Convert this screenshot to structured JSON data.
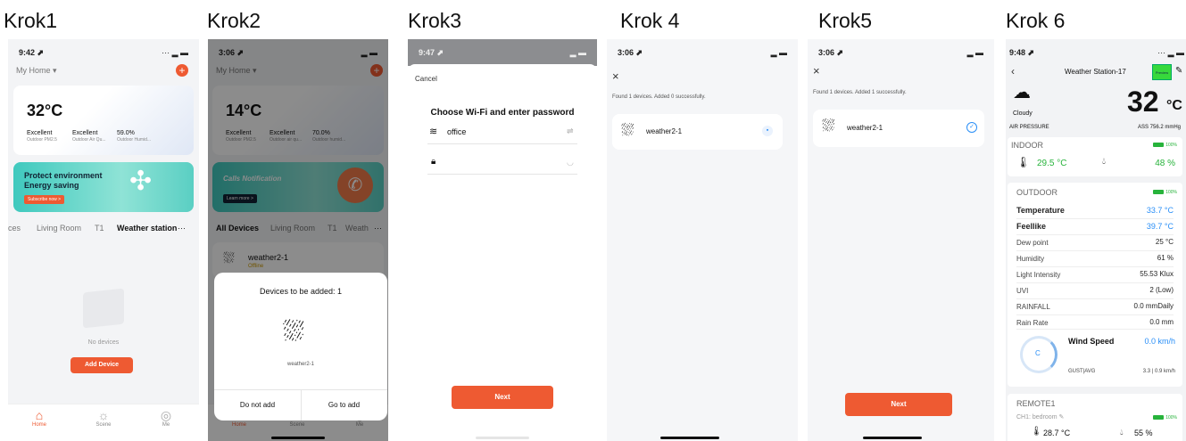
{
  "captions": [
    "Krok1",
    "Krok2",
    "Krok3",
    "Krok 4",
    "Krok5",
    "Krok 6"
  ],
  "colors": {
    "accent": "#ee5a32",
    "green": "#27b33b",
    "blue": "#2a8ff7"
  },
  "p1": {
    "time": "9:42 ⬈",
    "home": "My Home ▾",
    "temp": "32°C",
    "stats": [
      {
        "v": "Excellent",
        "l": "Outdoor PM2.5"
      },
      {
        "v": "Excellent",
        "l": "Outdoor Air Qu..."
      },
      {
        "v": "59.0%",
        "l": "Outdoor Humid..."
      }
    ],
    "banner_line1": "Protect environment",
    "banner_line2": "Energy saving",
    "banner_btn": "Subscribe now >",
    "rooms": [
      "ces",
      "Living Room",
      "T1",
      "Weather station",
      "···"
    ],
    "empty": "No devices",
    "add": "Add Device",
    "tabs": [
      "Home",
      "Scene",
      "Me"
    ]
  },
  "p2": {
    "time": "3:06 ⬈",
    "home": "My Home ▾",
    "temp": "14°C",
    "stats": [
      {
        "v": "Excellent",
        "l": "Outdoor PM2.5"
      },
      {
        "v": "Excellent",
        "l": "Outdoor air qu..."
      },
      {
        "v": "70.0%",
        "l": "Outdoor humid..."
      }
    ],
    "banner": "Calls Notification",
    "banner_btn": "Learn more >",
    "rooms": [
      "All Devices",
      "Living Room",
      "T1",
      "Weath",
      "···"
    ],
    "device": "weather2-1",
    "device_status": "Offline",
    "dialog_title": "Devices to be added: 1",
    "dialog_device": "weather2-1",
    "btn_no": "Do not add",
    "btn_go": "Go to add",
    "tabs": [
      "Home",
      "Scene",
      "Me"
    ]
  },
  "p3": {
    "time": "9:47 ⬈",
    "cancel": "Cancel",
    "title": "Choose Wi-Fi and enter password",
    "ssid": "office",
    "pwd_placeholder": "",
    "next": "Next"
  },
  "p4": {
    "time": "3:06 ⬈",
    "found": "Found 1 devices. Added 0 successfully.",
    "device": "weather2-1"
  },
  "p5": {
    "time": "3:06 ⬈",
    "found": "Found 1 devices. Added 1 successfully.",
    "device": "weather2-1",
    "next": "Next"
  },
  "p6": {
    "time": "9:48 ⬈",
    "title": "Weather Station-17",
    "preview": "Preview",
    "temp": "32",
    "unit": "°C",
    "cond": "Cloudy",
    "pressure_label": "AIR PRESSURE",
    "pressure": "ASS 756.2 mmHg",
    "indoor": "INDOOR",
    "indoor_batt": "100%",
    "indoor_temp": "29.5 °C",
    "indoor_hum": "48 %",
    "outdoor": "OUTDOOR",
    "outdoor_batt": "100%",
    "rows": [
      {
        "l": "Temperature",
        "v": "33.7 °C",
        "bold": true,
        "color": "#2a8ff7"
      },
      {
        "l": "Feellike",
        "v": "39.7 °C",
        "bold": true,
        "color": "#2a8ff7"
      },
      {
        "l": "Dew point",
        "v": "25 °C",
        "bold": false,
        "color": "#222"
      },
      {
        "l": "Humidity",
        "v": "61 %",
        "bold": false,
        "color": "#222"
      },
      {
        "l": "Light Intensity",
        "v": "55.53 Klux",
        "bold": false,
        "color": "#222"
      },
      {
        "l": "UVI",
        "v": "2 (Low)",
        "bold": false,
        "color": "#222"
      },
      {
        "l": "RAINFALL",
        "v": "0.0 mmDaily",
        "bold": false,
        "color": "#222"
      },
      {
        "l": "Rain Rate",
        "v": "0.0 mm",
        "bold": false,
        "color": "#222"
      }
    ],
    "wind_label": "Wind Speed",
    "wind_value": "0.0 km/h",
    "wind_dir": "C",
    "gust_label": "GUST|AVG",
    "gust_value": "3.3 | 0.9 km/h",
    "remote": "REMOTE1",
    "ch": "CH1: bedroom ✎",
    "remote_batt": "100%",
    "remote_temp": "28.7 °C",
    "remote_hum": "55 %"
  }
}
